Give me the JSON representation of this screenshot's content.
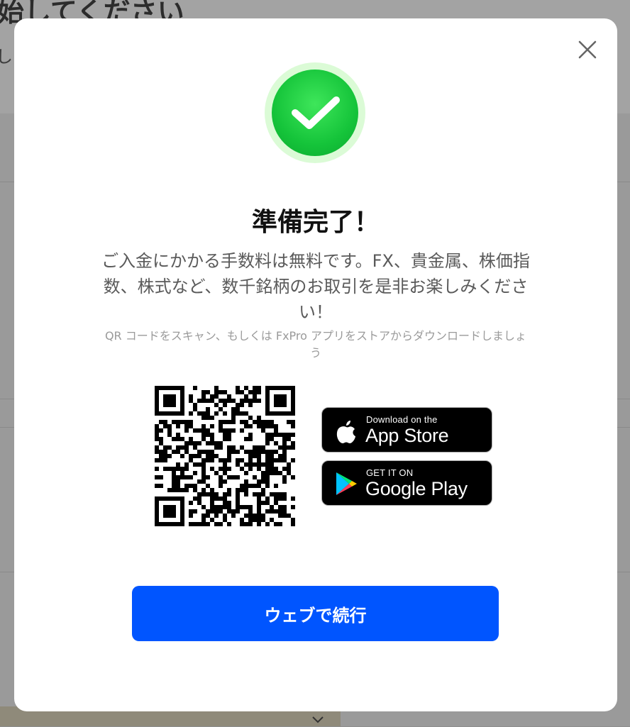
{
  "background": {
    "title": "始してください",
    "subtitle": "し"
  },
  "modal": {
    "title": "準備完了！",
    "description": "ご入金にかかる手数料は無料です。FX、貴金属、株価指数、株式など、数千銘柄のお取引を是非お楽しみください！",
    "hint": "QR コードをスキャン、もしくは FxPro アプリをストアからダウンロードしましょう",
    "app_store": {
      "small": "Download on the",
      "big": "App Store"
    },
    "google_play": {
      "small": "GET IT ON",
      "big": "Google Play"
    },
    "continue_label": "ウェブで続行"
  },
  "colors": {
    "accent": "#0055ff",
    "success": "#15c43a"
  }
}
